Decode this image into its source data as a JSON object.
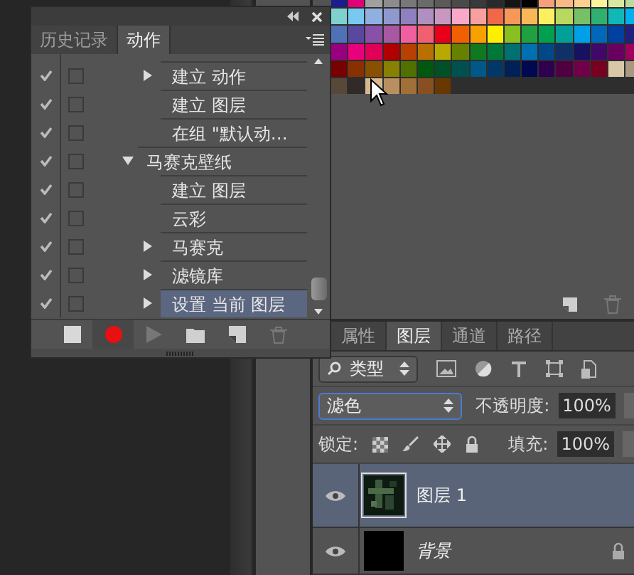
{
  "swatches_panel": {
    "swatches": [
      {
        "color": "#1c1c8c"
      },
      {
        "color": "#e0007a"
      },
      {
        "color": "#a0a0a0"
      },
      {
        "color": "#8c8c8c"
      },
      {
        "color": "#787878"
      },
      {
        "color": "#6a6a6a"
      },
      {
        "color": "#5a5a5a"
      },
      {
        "color": "#4a4a4a"
      },
      {
        "color": "#3a3a3a"
      },
      {
        "color": "#2a2a2a"
      },
      {
        "color": "#151515"
      },
      {
        "color": "#000000"
      },
      {
        "color": "#f5a07a"
      },
      {
        "color": "#f8b888"
      },
      {
        "color": "#fcd090"
      },
      {
        "color": "#fcf49c"
      },
      {
        "color": "#d8e8a0"
      },
      {
        "color": "#b8dca0"
      },
      {
        "color": "#80d0d0"
      },
      {
        "color": "#78c8f0"
      },
      {
        "color": "#90b0e0"
      },
      {
        "color": "#9098d0"
      },
      {
        "color": "#9080c0"
      },
      {
        "color": "#b090c0"
      },
      {
        "color": "#c898c0"
      },
      {
        "color": "#f8a8c8"
      },
      {
        "color": "#f8a0a0"
      },
      {
        "color": "#f06848"
      },
      {
        "color": "#f89858"
      },
      {
        "color": "#f8b858"
      },
      {
        "color": "#fcf060"
      },
      {
        "color": "#b8d860"
      },
      {
        "color": "#78c068"
      },
      {
        "color": "#30b070"
      },
      {
        "color": "#10b8b8"
      },
      {
        "color": "#00b0f0"
      },
      {
        "color": "#5070b8"
      },
      {
        "color": "#5848a0"
      },
      {
        "color": "#8850a8"
      },
      {
        "color": "#a858a0"
      },
      {
        "color": "#f060a0"
      },
      {
        "color": "#f06070"
      },
      {
        "color": "#e80018"
      },
      {
        "color": "#f06000"
      },
      {
        "color": "#f8a000"
      },
      {
        "color": "#fcf000"
      },
      {
        "color": "#88c020"
      },
      {
        "color": "#20a040"
      },
      {
        "color": "#00a050"
      },
      {
        "color": "#00a098"
      },
      {
        "color": "#00a0e8"
      },
      {
        "color": "#0068b8"
      },
      {
        "color": "#0040a0"
      },
      {
        "color": "#202080"
      },
      {
        "color": "#980080"
      },
      {
        "color": "#e8007c"
      },
      {
        "color": "#e00058"
      },
      {
        "color": "#b00000"
      },
      {
        "color": "#b84000"
      },
      {
        "color": "#b87000"
      },
      {
        "color": "#b8a800"
      },
      {
        "color": "#688000"
      },
      {
        "color": "#107820"
      },
      {
        "color": "#007838"
      },
      {
        "color": "#007070"
      },
      {
        "color": "#0070b0"
      },
      {
        "color": "#004888"
      },
      {
        "color": "#103068"
      },
      {
        "color": "#181060"
      },
      {
        "color": "#400868"
      },
      {
        "color": "#680060"
      },
      {
        "color": "#a00060"
      },
      {
        "color": "#780000"
      },
      {
        "color": "#883000"
      },
      {
        "color": "#885000"
      },
      {
        "color": "#888000"
      },
      {
        "color": "#507000"
      },
      {
        "color": "#005810"
      },
      {
        "color": "#005028"
      },
      {
        "color": "#005050"
      },
      {
        "color": "#005888"
      },
      {
        "color": "#003868"
      },
      {
        "color": "#002058"
      },
      {
        "color": "#000850"
      },
      {
        "color": "#300050"
      },
      {
        "color": "#500040"
      },
      {
        "color": "#700048"
      },
      {
        "color": "#780020"
      },
      {
        "color": "#d8c8a8"
      },
      {
        "color": "#a89880"
      },
      {
        "color": "#584838"
      },
      {
        "color": "#302a28"
      },
      {
        "color": "#d8b890"
      },
      {
        "color": "#b89060"
      },
      {
        "color": "#a07038"
      },
      {
        "color": "#885020"
      },
      {
        "color": "#683800"
      }
    ],
    "toolbar": [
      {
        "kind": "new"
      },
      {
        "kind": "delete"
      }
    ]
  },
  "actions_panel": {
    "tabs": [
      {
        "label": "历史记录",
        "selected": false
      },
      {
        "label": "动作",
        "selected": true
      }
    ],
    "items": [
      {
        "kind": "group",
        "children": [
          {
            "label": "建立 动作",
            "enabled": true,
            "dialog": false,
            "expanded": false,
            "selected": false
          },
          {
            "label": "建立 图层",
            "enabled": true,
            "dialog": false,
            "selected": false
          },
          {
            "label": "在组 \"默认动…",
            "enabled": true,
            "dialog": false,
            "selected": false
          }
        ]
      },
      {
        "kind": "action",
        "label": "马赛克壁纸",
        "enabled": true,
        "dialog": false,
        "expanded": true,
        "selected": false,
        "children": [
          {
            "label": "建立 图层",
            "enabled": true,
            "dialog": false,
            "selected": false
          },
          {
            "label": "云彩",
            "enabled": true,
            "dialog": false,
            "selected": false
          },
          {
            "label": "马赛克",
            "enabled": true,
            "dialog": false,
            "expanded": false,
            "selected": false
          },
          {
            "label": "滤镜库",
            "enabled": true,
            "dialog": false,
            "expanded": false,
            "selected": false
          },
          {
            "label": "设置 当前 图层",
            "enabled": true,
            "dialog": false,
            "expanded": false,
            "selected": true
          }
        ]
      }
    ],
    "toolbar": [
      {
        "kind": "stop",
        "disabled": false
      },
      {
        "kind": "record",
        "disabled": false
      },
      {
        "kind": "play",
        "disabled": true
      },
      {
        "kind": "folder",
        "disabled": false
      },
      {
        "kind": "new",
        "disabled": false
      },
      {
        "kind": "delete",
        "disabled": true
      }
    ]
  },
  "layers_panel": {
    "tabs": [
      {
        "label": "属性",
        "selected": false
      },
      {
        "label": "图层",
        "selected": true
      },
      {
        "label": "通道",
        "selected": false
      },
      {
        "label": "路径",
        "selected": false
      }
    ],
    "filter": {
      "value": "类型"
    },
    "blend_mode": "滤色",
    "opacity_label": "不透明度:",
    "opacity": "100%",
    "lock_label": "锁定:",
    "fill_label": "填充:",
    "fill": "100%",
    "layers": [
      {
        "name": "图层 1",
        "kind": "pattern",
        "visible": true,
        "selected": true,
        "locked": false
      },
      {
        "name": "背景",
        "kind": "background",
        "visible": true,
        "selected": false,
        "locked": true
      }
    ]
  }
}
